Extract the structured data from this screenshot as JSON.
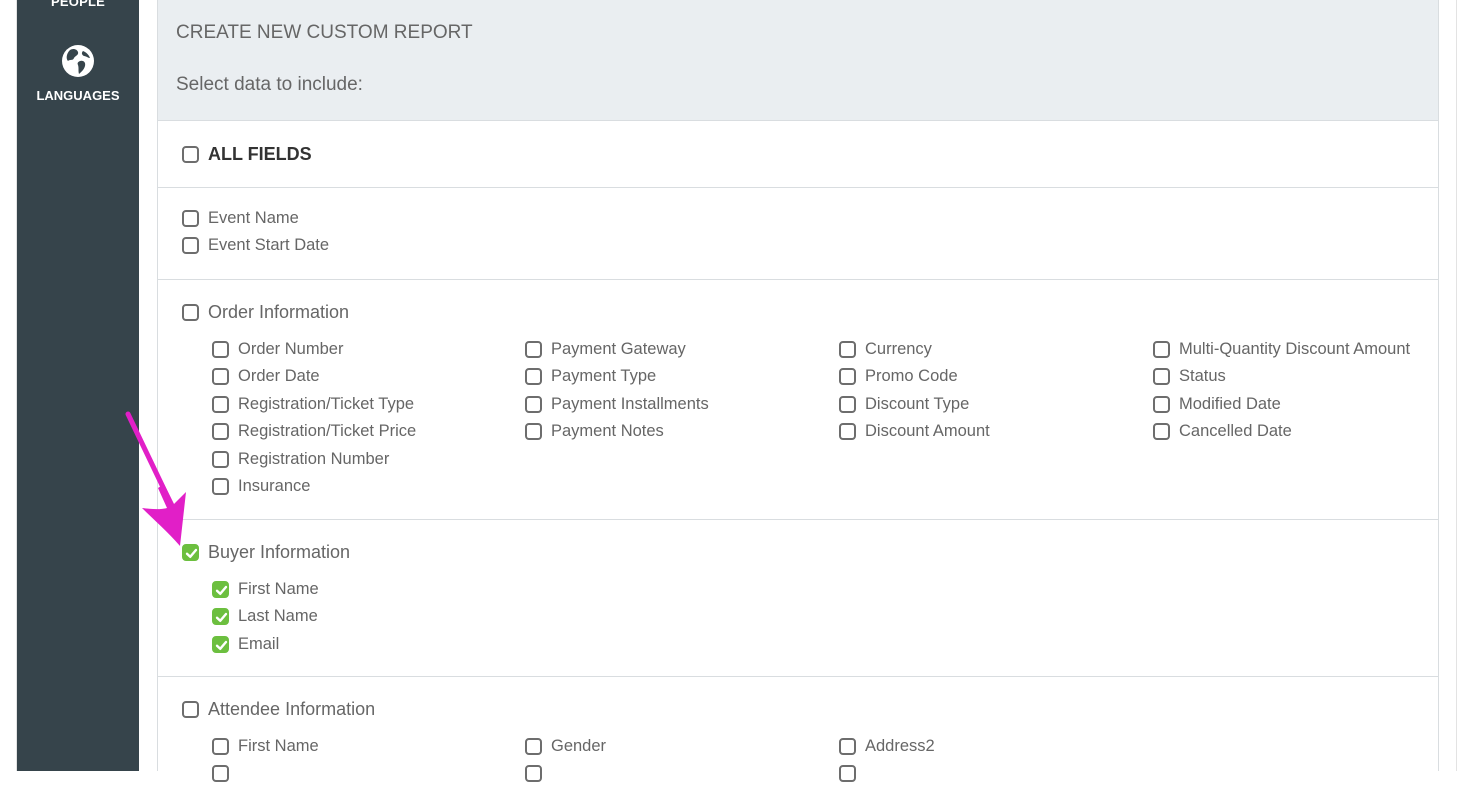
{
  "sidebar": {
    "items": [
      {
        "label": "PEOPLE"
      },
      {
        "label": "LANGUAGES",
        "icon": "globe-icon"
      }
    ]
  },
  "report": {
    "title": "CREATE NEW CUSTOM REPORT",
    "subtitle": "Select data to include:",
    "all_fields": {
      "label": "ALL FIELDS",
      "checked": false
    },
    "event": [
      {
        "label": "Event Name",
        "checked": false
      },
      {
        "label": "Event Start Date",
        "checked": false
      }
    ],
    "order": {
      "label": "Order Information",
      "checked": false,
      "col1": [
        "Order Number",
        "Order Date",
        "Registration/Ticket Type",
        "Registration/Ticket Price",
        "Registration Number",
        "Insurance"
      ],
      "col2": [
        "Payment Gateway",
        "Payment Type",
        "Payment Installments",
        "Payment Notes"
      ],
      "col3": [
        "Currency",
        "Promo Code",
        "Discount Type",
        "Discount Amount"
      ],
      "col4": [
        "Multi-Quantity Discount Amount",
        "Status",
        "Modified Date",
        "Cancelled Date"
      ]
    },
    "buyer": {
      "label": "Buyer Information",
      "checked": true,
      "fields": [
        "First Name",
        "Last Name",
        "Email"
      ]
    },
    "attendee": {
      "label": "Attendee Information",
      "checked": false,
      "col1": [
        "First Name"
      ],
      "col2": [
        "Gender"
      ],
      "col3": [
        "Address2"
      ]
    }
  },
  "colors": {
    "sidebar": "#36444b",
    "checked": "#6cbf3f",
    "annotation_arrow": "#e11fc7"
  }
}
